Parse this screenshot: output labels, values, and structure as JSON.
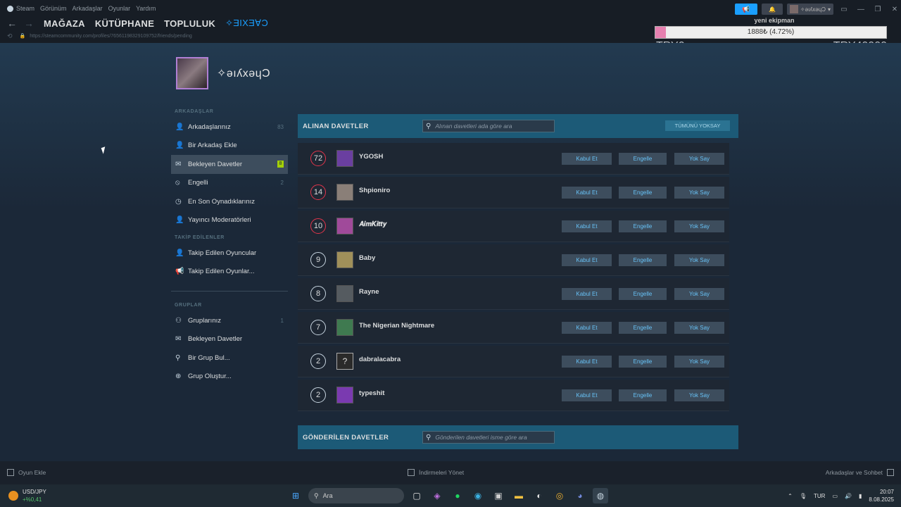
{
  "menubar": {
    "app": "Steam",
    "items": [
      "Görünüm",
      "Arkadaşlar",
      "Oyunlar",
      "Yardım"
    ]
  },
  "nav": {
    "tabs": [
      "MAĞAZA",
      "KÜTÜPHANE",
      "TOPLULUK",
      "✧ƎIXƎⱯƆ"
    ]
  },
  "url": "https://steamcommunity.com/profiles/76561198329109752/friends/pending",
  "topbar": {
    "username": "✧ǝıʎxǝɥƆ"
  },
  "overlay": {
    "title": "yeni ekipman",
    "progress_text": "1888₺ (4.72%)",
    "progress_pct": 4.72,
    "left_label": "TRY0",
    "right_label": "TRY40000"
  },
  "profile": {
    "name": "✧ǝıʎxǝɥƆ"
  },
  "sidebar": {
    "sec1": "ARKADAŞLAR",
    "friends_label": "Arkadaşlarınız",
    "friends_count": "83",
    "add_label": "Bir Arkadaş Ekle",
    "pending_label": "Bekleyen Davetler",
    "pending_count": "8",
    "blocked_label": "Engelli",
    "blocked_count": "2",
    "recent_label": "En Son Oynadıklarınız",
    "mods_label": "Yayıncı Moderatörleri",
    "sec2": "TAKİP EDİLENLER",
    "fplayers_label": "Takip Edilen Oyuncular",
    "fgames_label": "Takip Edilen Oyunlar...",
    "sec3": "GRUPLAR",
    "groups_label": "Gruplarınız",
    "groups_count": "1",
    "gpending_label": "Bekleyen Davetler",
    "gfind_label": "Bir Grup Bul...",
    "gcreate_label": "Grup Oluştur..."
  },
  "received": {
    "title": "ALINAN DAVETLER",
    "search_placeholder": "Alınan davetleri ada göre ara",
    "ignore_all": "TÜMÜNÜ YOKSAY"
  },
  "sent": {
    "title": "GÖNDERİLEN DAVETLER",
    "search_placeholder": "Gönderilen davetleri isme göre ara"
  },
  "buttons": {
    "accept": "Kabul Et",
    "block": "Engelle",
    "ignore": "Yok Say"
  },
  "invites": [
    {
      "level": "72",
      "name": "YGOSH",
      "red": true,
      "color": "#6a3fa0"
    },
    {
      "level": "14",
      "name": "Shpioniro",
      "red": true,
      "color": "#8a7f78"
    },
    {
      "level": "10",
      "name": "𝑨𝒊𝒎𝑲𝒊𝒕𝒕𝒚",
      "red": true,
      "color": "#a04a9a"
    },
    {
      "level": "9",
      "name": "Baby",
      "red": false,
      "color": "#a0905a"
    },
    {
      "level": "8",
      "name": "Rayne",
      "red": false,
      "color": "#555b60"
    },
    {
      "level": "7",
      "name": "The Nigerian Nightmare",
      "red": false,
      "color": "#3f7a50"
    },
    {
      "level": "2",
      "name": "dabralacabra",
      "red": false,
      "color": "#2a2a2a"
    },
    {
      "level": "2",
      "name": "typeshit",
      "red": false,
      "color": "#7a3ab0"
    }
  ],
  "footer": {
    "add_game": "Oyun Ekle",
    "downloads": "İndirmeleri Yönet",
    "friends_chat": "Arkadaşlar ve Sohbet"
  },
  "taskbar": {
    "currency": "USD/JPY",
    "change": "+%0,41",
    "search": "Ara",
    "lang": "TUR",
    "time": "20:07",
    "date": "8.08.2025"
  }
}
